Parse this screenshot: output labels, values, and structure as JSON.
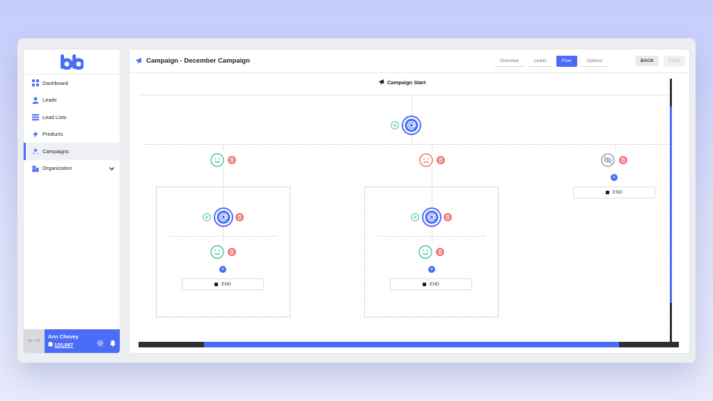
{
  "sidebar": {
    "logo_text": "bb",
    "items": [
      {
        "label": "Dashboard",
        "icon": "grid-icon"
      },
      {
        "label": "Leads",
        "icon": "user-icon"
      },
      {
        "label": "Lead Lists",
        "icon": "list-icon"
      },
      {
        "label": "Products",
        "icon": "lightning-icon"
      },
      {
        "label": "Campaigns",
        "icon": "sparkle-icon",
        "active": true
      },
      {
        "label": "Organization",
        "icon": "building-icon",
        "expandable": true
      }
    ],
    "user": {
      "avatar_placeholder": "60 × 60",
      "name": "Ann Chovey",
      "credits": "120,897"
    }
  },
  "header": {
    "title": "Campaign - December Campaign",
    "tabs": [
      "Overview",
      "Leads",
      "Flow",
      "Options"
    ],
    "active_tab": "Flow",
    "back_label": "BACK",
    "save_label": "SAVE"
  },
  "flow": {
    "start_label": "Campaign Start",
    "end_label": "END"
  },
  "colors": {
    "accent": "#4a6cf7",
    "positive": "#4fcb9b",
    "negative": "#ef7c7c",
    "neutral": "#9aa4b8"
  }
}
